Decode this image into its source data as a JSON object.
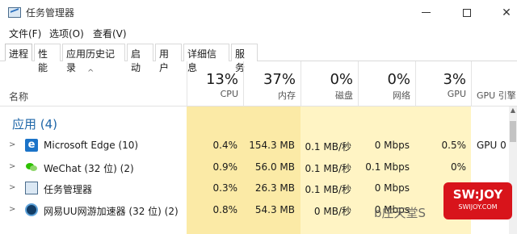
{
  "window": {
    "title": "任务管理器",
    "minimize_icon": "minimize-icon",
    "maximize_icon": "maximize-icon",
    "close_glyph": "✕"
  },
  "menu": [
    "文件(F)",
    "选项(O)",
    "查看(V)"
  ],
  "tabs": [
    "进程",
    "性能",
    "应用历史记录",
    "启动",
    "用户",
    "详细信息",
    "服务"
  ],
  "header": {
    "sort_glyph": "^",
    "name_label": "名称",
    "columns": [
      {
        "pct": "13%",
        "label": "CPU"
      },
      {
        "pct": "37%",
        "label": "内存"
      },
      {
        "pct": "0%",
        "label": "磁盘"
      },
      {
        "pct": "0%",
        "label": "网络"
      },
      {
        "pct": "3%",
        "label": "GPU"
      },
      {
        "pct": "",
        "label": "GPU 引擎"
      }
    ]
  },
  "group": {
    "label": "应用 (4)"
  },
  "rows": [
    {
      "name": "Microsoft Edge (10)",
      "icon": "edge-icon",
      "cpu": "0.4%",
      "mem": "154.3 MB",
      "disk": "0.1 MB/秒",
      "net": "0 Mbps",
      "gpu": "0.5%",
      "engine": "GPU 0"
    },
    {
      "name": "WeChat (32 位) (2)",
      "icon": "wechat-icon",
      "cpu": "0.9%",
      "mem": "56.0 MB",
      "disk": "0.1 MB/秒",
      "net": "0.1 Mbps",
      "gpu": "0%",
      "engine": ""
    },
    {
      "name": "任务管理器",
      "icon": "task-manager-icon",
      "cpu": "0.3%",
      "mem": "26.3 MB",
      "disk": "0.1 MB/秒",
      "net": "0 Mbps",
      "gpu": "",
      "engine": ""
    },
    {
      "name": "网易UU网游加速器 (32 位) (2)",
      "icon": "uu-accelerator-icon",
      "cpu": "0.8%",
      "mem": "54.3 MB",
      "disk": "0 MB/秒",
      "net": "0 Mbps",
      "gpu": "",
      "engine": ""
    }
  ],
  "watermark": {
    "text": "b庄天堂S",
    "badge_big": "SW:JOY",
    "badge_small": "SWIJOY.COM"
  },
  "colors": {
    "accent": "#1e66a8",
    "heat_light": "#fff4c4",
    "heat_dark": "#fbeaa6"
  }
}
